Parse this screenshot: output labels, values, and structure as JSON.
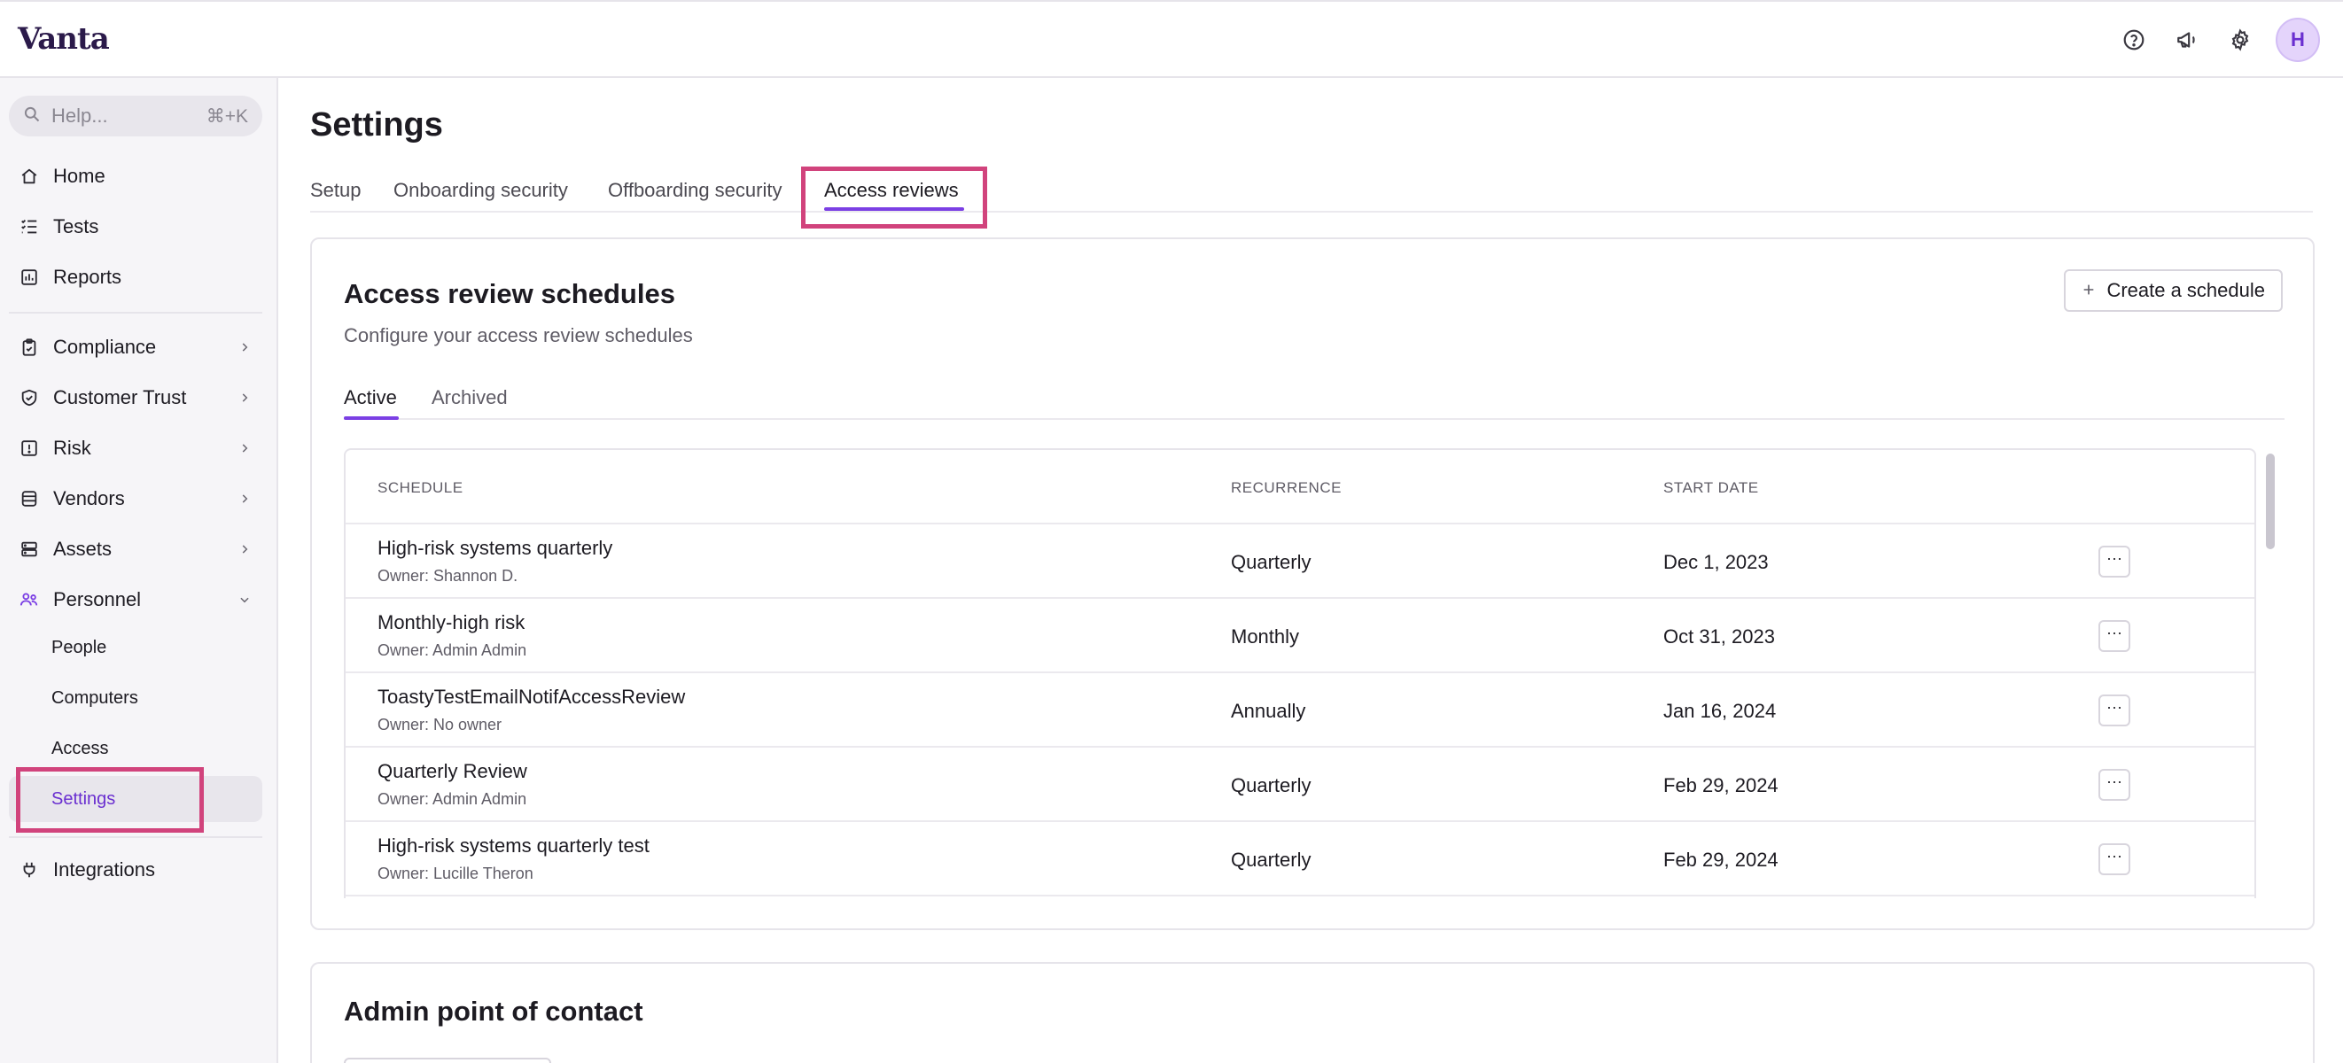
{
  "app": {
    "logo": "Vanta"
  },
  "topbar": {
    "icons": [
      "help-circle-icon",
      "megaphone-icon",
      "gear-icon"
    ],
    "avatar_initial": "H"
  },
  "sidebar": {
    "search": {
      "placeholder": "Help...",
      "shortcut": "⌘+K"
    },
    "items": [
      {
        "label": "Home",
        "icon": "home-icon"
      },
      {
        "label": "Tests",
        "icon": "checklist-icon"
      },
      {
        "label": "Reports",
        "icon": "bar-chart-icon"
      },
      {
        "label": "Compliance",
        "icon": "clipboard-check-icon"
      },
      {
        "label": "Customer Trust",
        "icon": "shield-check-icon"
      },
      {
        "label": "Risk",
        "icon": "alert-square-icon"
      },
      {
        "label": "Vendors",
        "icon": "database-icon"
      },
      {
        "label": "Assets",
        "icon": "server-icon"
      },
      {
        "label": "Personnel",
        "icon": "users-icon"
      },
      {
        "label": "Integrations",
        "icon": "plug-icon"
      }
    ],
    "personnel_sub": [
      "People",
      "Computers",
      "Access",
      "Settings"
    ],
    "active_sub": "Settings"
  },
  "main": {
    "title": "Settings",
    "tabs": [
      "Setup",
      "Onboarding security",
      "Offboarding security",
      "Access reviews"
    ],
    "active_tab": "Access reviews"
  },
  "schedules_card": {
    "title": "Access review schedules",
    "subtitle": "Configure your access review schedules",
    "create_button": "Create a schedule",
    "subtabs": [
      "Active",
      "Archived"
    ],
    "active_subtab": "Active",
    "columns": [
      "SCHEDULE",
      "RECURRENCE",
      "START DATE"
    ],
    "rows": [
      {
        "name": "High-risk systems quarterly",
        "owner": "Owner: Shannon D.",
        "recurrence": "Quarterly",
        "start_date": "Dec 1, 2023"
      },
      {
        "name": "Monthly-high risk",
        "owner": "Owner: Admin Admin",
        "recurrence": "Monthly",
        "start_date": "Oct 31, 2023"
      },
      {
        "name": "ToastyTestEmailNotifAccessReview",
        "owner": "Owner: No owner",
        "recurrence": "Annually",
        "start_date": "Jan 16, 2024"
      },
      {
        "name": "Quarterly Review",
        "owner": "Owner: Admin Admin",
        "recurrence": "Quarterly",
        "start_date": "Feb 29, 2024"
      },
      {
        "name": "High-risk systems quarterly test",
        "owner": "Owner: Lucille Theron",
        "recurrence": "Quarterly",
        "start_date": "Feb 29, 2024"
      }
    ],
    "more_label": "···"
  },
  "contact_card": {
    "title": "Admin point of contact"
  },
  "colors": {
    "accent": "#7b3fe4",
    "highlight": "#d1437c"
  }
}
